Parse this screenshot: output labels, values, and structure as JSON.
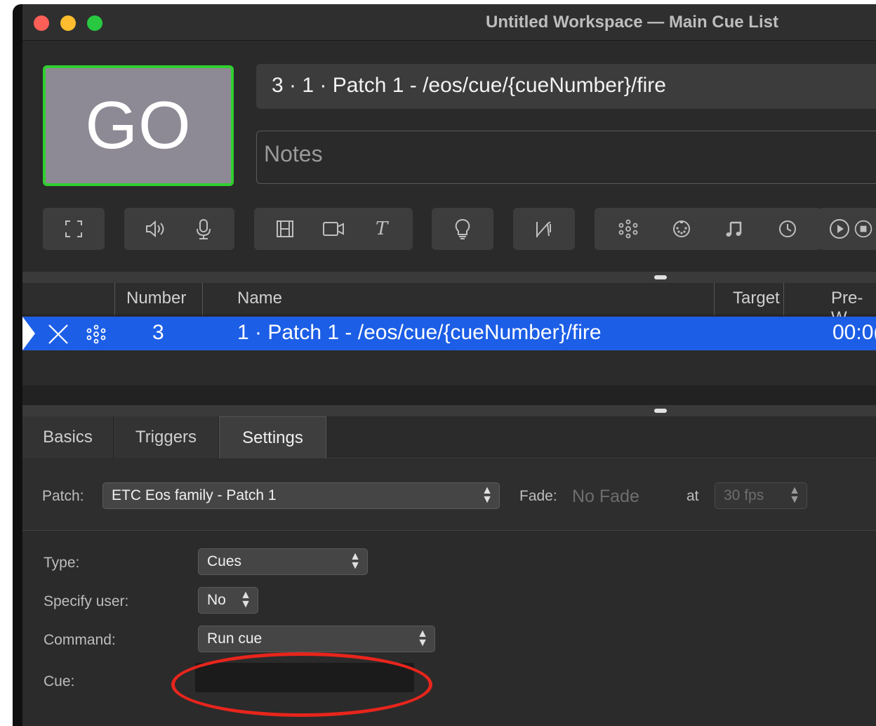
{
  "window": {
    "title": "Untitled Workspace — Main Cue List"
  },
  "go_button": {
    "label": "GO"
  },
  "cue_fields": {
    "display_name": "3 · 1 · Patch 1 - /eos/cue/{cueNumber}/fire",
    "notes_placeholder": "Notes"
  },
  "toolbar": {
    "groups": [
      [
        "fullscreen-icon"
      ],
      [
        "speaker-icon",
        "microphone-icon"
      ],
      [
        "film-icon",
        "video-camera-icon",
        "text-icon"
      ],
      [
        "lightbulb-icon"
      ],
      [
        "fade-icon"
      ],
      [
        "network-icon",
        "midi-icon",
        "music-note-icon",
        "clock-icon"
      ],
      [
        "play-icon",
        "stop-icon"
      ]
    ]
  },
  "cue_table": {
    "columns": [
      "Number",
      "Name",
      "Target",
      "Pre-W"
    ],
    "rows": [
      {
        "number": "3",
        "name": "1 · Patch 1 - /eos/cue/{cueNumber}/fire",
        "prewait": "00:0("
      }
    ]
  },
  "inspector": {
    "tabs": [
      "Basics",
      "Triggers",
      "Settings"
    ],
    "active_tab": "Settings",
    "patch_label": "Patch:",
    "patch_value": "ETC Eos family - Patch 1",
    "fade_label": "Fade:",
    "fade_value": "No Fade",
    "at_label": "at",
    "fps_value": "30 fps",
    "fields": [
      {
        "label": "Type:",
        "value": "Cues"
      },
      {
        "label": "Specify user:",
        "value": "No"
      },
      {
        "label": "Command:",
        "value": "Run cue"
      },
      {
        "label": "Cue:",
        "value": ""
      }
    ]
  },
  "colors": {
    "go_border": "#2fd02f",
    "selection": "#1c5ee6",
    "annotation": "#e8251c"
  }
}
